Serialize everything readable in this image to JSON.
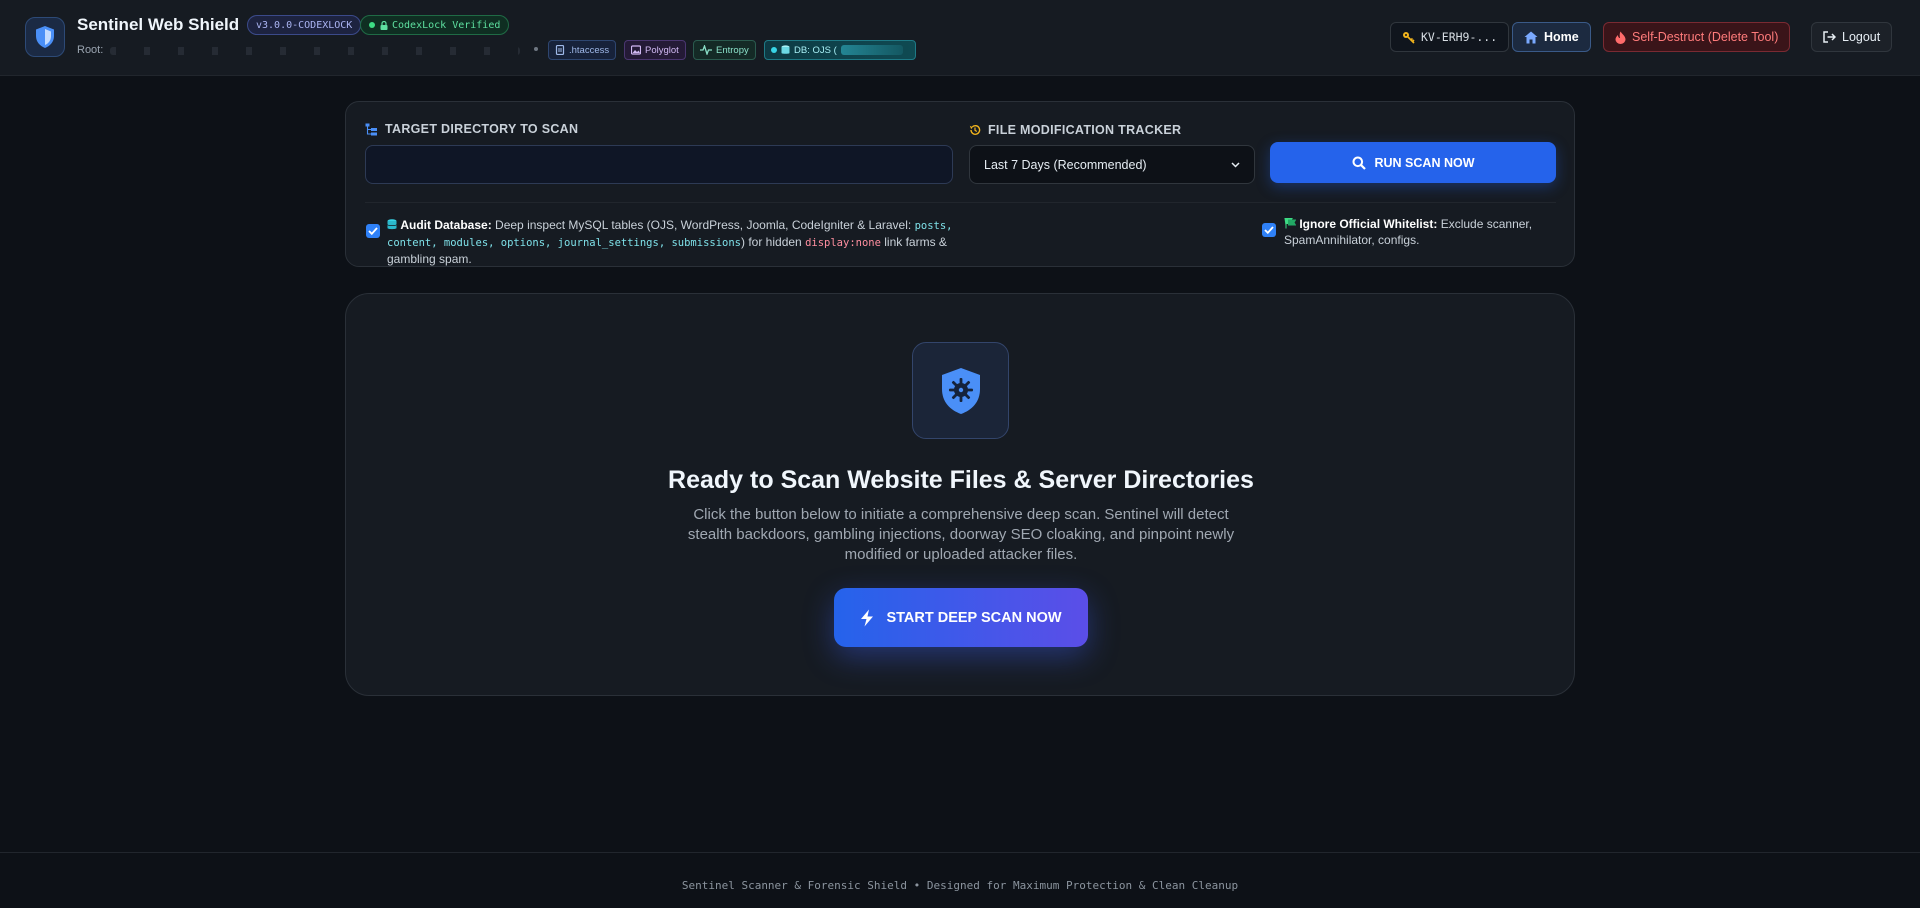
{
  "header": {
    "app_title": "Sentinel Web Shield",
    "version_badge": "v3.0.0-CODEXLOCK",
    "verified_badge": "CodexLock Verified",
    "root_label": "Root:",
    "chips": {
      "htaccess": ".htaccess",
      "polyglot": "Polyglot",
      "entropy": "Entropy",
      "db": "DB: OJS ("
    },
    "license_key": "KV-ERH9-...",
    "home_label": "Home",
    "self_destruct_label": "Self-Destruct (Delete Tool)",
    "logout_label": "Logout"
  },
  "controls": {
    "target_label": "TARGET DIRECTORY TO SCAN",
    "target_value": "",
    "tracker_label": "FILE MODIFICATION TRACKER",
    "tracker_selected": "Last 7 Days (Recommended)",
    "run_button": "RUN SCAN NOW",
    "audit_db": {
      "checked": true,
      "title": "Audit Database:",
      "text_1": "Deep inspect MySQL tables (OJS, WordPress, Joomla, CodeIgniter & Laravel: ",
      "code_tables": "posts, content, modules, options, journal_settings, submissions",
      "text_2": ") for hidden ",
      "code_style": "display:none",
      "text_3": " link farms & gambling spam."
    },
    "ignore_whitelist": {
      "checked": true,
      "title": "Ignore Official Whitelist:",
      "text": "Exclude scanner, SpamAnnihilator, configs."
    }
  },
  "hero": {
    "title": "Ready to Scan Website Files & Server Directories",
    "description": "Click the button below to initiate a comprehensive deep scan. Sentinel will detect stealth backdoors, gambling injections, doorway SEO cloaking, and pinpoint newly modified or uploaded attacker files.",
    "button": "START DEEP SCAN NOW"
  },
  "footer": {
    "text": "Sentinel Scanner & Forensic Shield • Designed for Maximum Protection & Clean Cleanup"
  },
  "colors": {
    "accent": "#2563eb",
    "danger": "#ff7b7b",
    "success": "#5ee0a0",
    "background": "#0d1117"
  }
}
